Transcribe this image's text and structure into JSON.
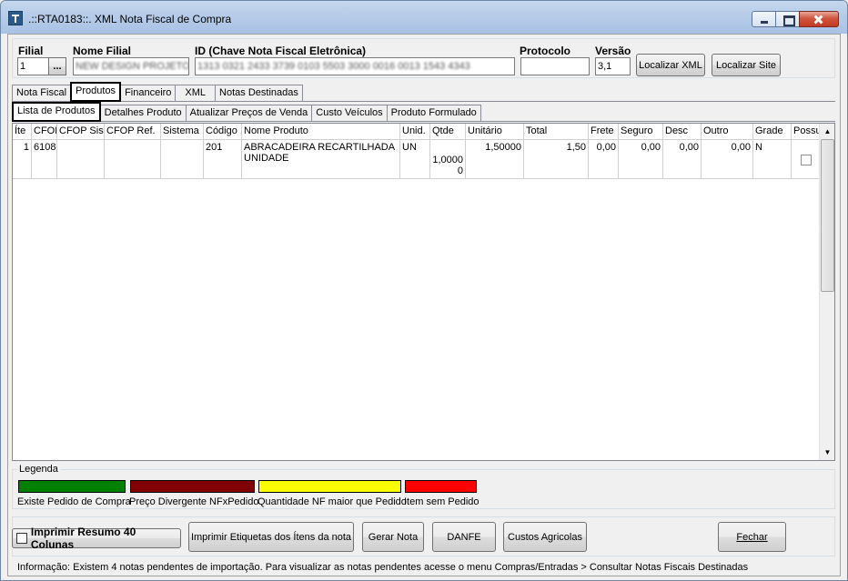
{
  "window": {
    "title": ".::RTA0183::. XML Nota Fiscal de Compra"
  },
  "header": {
    "filial_label": "Filial",
    "filial_value": "1",
    "filial_lookup": "...",
    "nome_filial_label": "Nome Filial",
    "nome_filial_value": "NEW DESIGN PROJETO SI",
    "chave_label": "ID (Chave Nota Fiscal Eletrônica)",
    "chave_value": "1313 0321 2433 3739 0103 5503 3000 0016 0013 1543 4343",
    "protocolo_label": "Protocolo",
    "protocolo_value": "",
    "versao_label": "Versão",
    "versao_value": "3,1",
    "localizar_xml": "Localizar XML",
    "localizar_site": "Localizar Site"
  },
  "main_tabs": [
    {
      "label": "Nota Fiscal"
    },
    {
      "label": "Produtos"
    },
    {
      "label": "Financeiro"
    },
    {
      "label": "XML"
    },
    {
      "label": "Notas Destinadas"
    }
  ],
  "sub_tabs": [
    {
      "label": "Lista de Produtos"
    },
    {
      "label": "Detalhes Produto"
    },
    {
      "label": "Atualizar Preços de Venda"
    },
    {
      "label": "Custo Veículos"
    },
    {
      "label": "Produto Formulado"
    }
  ],
  "grid": {
    "columns": [
      "Íte",
      "CFOF",
      "CFOP Sis.",
      "CFOP Ref.",
      "Sistema",
      "Código",
      "Nome Produto",
      "Unid.",
      "Qtde",
      "Unitário",
      "Total",
      "Frete",
      "Seguro",
      "Desc",
      "Outro",
      "Grade",
      "Possu"
    ],
    "rows": [
      {
        "item": "1",
        "cfop": "6108",
        "cfop_sis": "",
        "cfop_ref": "",
        "sistema": "",
        "codigo": "201",
        "nome": "ABRACADEIRA RECARTILHADA UNIDADE",
        "unid": "UN",
        "qtde": "1,0000 0",
        "unitario": "1,50000",
        "total": "1,50",
        "frete": "0,00",
        "seguro": "0,00",
        "desc": "0,00",
        "outro": "0,00",
        "grade": "N"
      }
    ]
  },
  "legend": {
    "title": "Legenda",
    "items": [
      {
        "label": "Existe Pedido de Compra",
        "color": "#008000"
      },
      {
        "label": "Preço Divergente NFxPedido",
        "color": "#800000"
      },
      {
        "label": "Quantidade NF maior que Pedido",
        "color": "#ffff00"
      },
      {
        "label": "Item sem Pedido",
        "color": "#ff0000"
      }
    ]
  },
  "footer": {
    "imprimir_resumo": "Imprimir Resumo 40 Colunas",
    "imprimir_etiquetas": "Imprimir Etiquetas dos Ítens da nota",
    "gerar_nota": "Gerar Nota",
    "danfe": "DANFE",
    "custos": "Custos Agricolas",
    "fechar": "Fechar",
    "info": "Informação: Existem 4 notas pendentes de importação. Para visualizar as notas pendentes acesse o menu Compras/Entradas > Consultar Notas Fiscais Destinadas"
  }
}
